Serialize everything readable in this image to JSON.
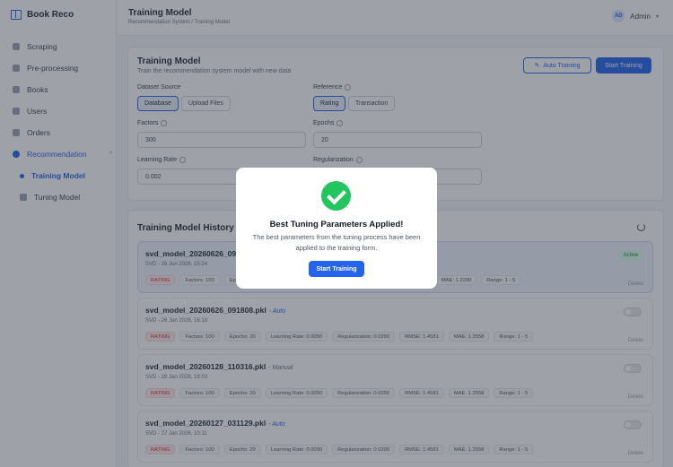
{
  "app": {
    "name": "Book Reco"
  },
  "sidebar": {
    "items": [
      {
        "label": "Scraping",
        "icon": "globe-icon"
      },
      {
        "label": "Pre-processing",
        "icon": "filter-icon"
      },
      {
        "label": "Books",
        "icon": "book-icon"
      },
      {
        "label": "Users",
        "icon": "users-icon"
      },
      {
        "label": "Orders",
        "icon": "cart-icon"
      },
      {
        "label": "Recommendation",
        "icon": "sparkle-icon"
      }
    ],
    "sub_items": [
      {
        "label": "Training Model",
        "icon": "bulb-icon"
      },
      {
        "label": "Tuning Model",
        "icon": "tune-icon"
      }
    ]
  },
  "topbar": {
    "title": "Training Model",
    "breadcrumb": "Recommendation System  /  Training Model",
    "user": {
      "initials": "AD",
      "name": "Admin"
    }
  },
  "form": {
    "title": "Training Model",
    "subtitle": "Train the recommendation system model with new data",
    "auto_button": "Auto Training",
    "start_button": "Start Training",
    "dataset_source": {
      "label": "Dataset Source",
      "options": [
        "Database",
        "Upload Files"
      ],
      "selected": "Database"
    },
    "reference": {
      "label": "Reference",
      "options": [
        "Rating",
        "Transaction"
      ],
      "selected": "Rating"
    },
    "factors": {
      "label": "Factors",
      "value": "300"
    },
    "epochs": {
      "label": "Epochs",
      "value": "20"
    },
    "learning_rate": {
      "label": "Learning Rate",
      "value": "0.002"
    },
    "regularization": {
      "label": "Regularization",
      "value": ""
    }
  },
  "history": {
    "title": "Training Model History (20",
    "rows": [
      {
        "name": "svd_model_20260626_092",
        "tag": "",
        "meta": "SVD - 26 Jun 2026, 15:24",
        "active": true,
        "badge": "Active",
        "pills": [
          "RATING",
          "Factors: 100",
          "Ep",
          "MAE: 1.2290",
          "Range: 1 - 5"
        ],
        "delete": "Delete"
      },
      {
        "name": "svd_model_20260626_091808.pkl",
        "tag": "Auto",
        "meta": "SVD - 26 Jun 2026, 16:18",
        "active": false,
        "pills": [
          "RATING",
          "Factors: 100",
          "Epochs: 20",
          "Learning Rate: 0.0050",
          "Regularization: 0.0200",
          "RMSE: 1.4581",
          "MAE: 1.2558",
          "Range: 1 - 5"
        ],
        "delete": "Delete"
      },
      {
        "name": "svd_model_20260128_110316.pkl",
        "tag": "Manual",
        "meta": "SVD - 28 Jan 2026, 18:03",
        "active": false,
        "pills": [
          "RATING",
          "Factors: 100",
          "Epochs: 20",
          "Learning Rate: 0.0050",
          "Regularization: 0.0200",
          "RMSE: 1.4581",
          "MAE: 1.2558",
          "Range: 1 - 5"
        ],
        "delete": "Delete"
      },
      {
        "name": "svd_model_20260127_031129.pkl",
        "tag": "Auto",
        "meta": "SVD - 27 Jan 2026, 10:11",
        "active": false,
        "pills": [
          "RATING",
          "Factors: 100",
          "Epochs: 20",
          "Learning Rate: 0.0050",
          "Regularization: 0.0200",
          "RMSE: 1.4581",
          "MAE: 1.2558",
          "Range: 1 - 5"
        ],
        "delete": "Delete"
      }
    ]
  },
  "modal": {
    "title": "Best Tuning Parameters Applied!",
    "body": "The best parameters from the tuning process have been applied to the training form.",
    "button": "Start Training"
  },
  "colors": {
    "accent": "#2563eb",
    "success": "#22c55e",
    "danger": "#dc2626"
  }
}
